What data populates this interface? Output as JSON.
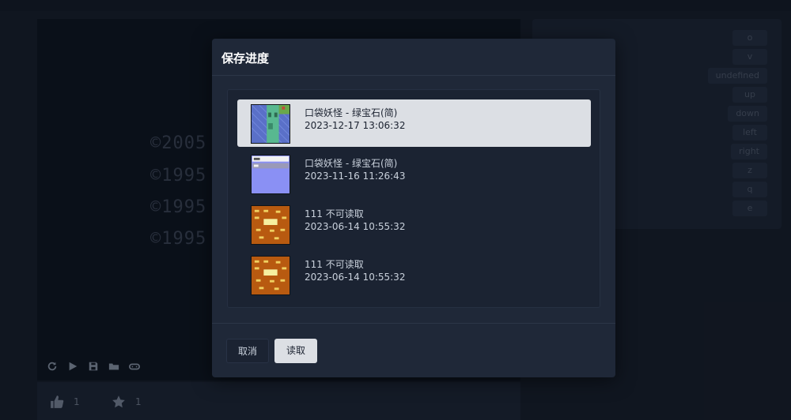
{
  "stage": {
    "copyright_lines": [
      "©2005",
      "©1995 -",
      "©1995 -",
      "©1995 -"
    ],
    "toolbar": [
      "restart-icon",
      "play-icon",
      "save-icon",
      "folder-icon",
      "gamepad-icon"
    ]
  },
  "stats": {
    "likes": "1",
    "stars": "1"
  },
  "keymap": [
    "o",
    "v",
    "undefined",
    "up",
    "down",
    "left",
    "right",
    "z",
    "q",
    "e"
  ],
  "modal": {
    "title": "保存进度",
    "saves": [
      {
        "name": "口袋妖怪 - 绿宝石(简)",
        "date": "2023-12-17 13:06:32",
        "selected": true,
        "thumb": "map"
      },
      {
        "name": "口袋妖怪 - 绿宝石(简)",
        "date": "2023-11-16 11:26:43",
        "selected": false,
        "thumb": "menu"
      },
      {
        "name": "111 不可读取",
        "date": "2023-06-14 10:55:32",
        "selected": false,
        "thumb": "brick"
      },
      {
        "name": "111 不可读取",
        "date": "2023-06-14 10:55:32",
        "selected": false,
        "thumb": "brick"
      }
    ],
    "cancel_label": "取消",
    "load_label": "读取"
  },
  "colors": {
    "accent": "#dcdfe4",
    "panel": "#1f2838",
    "background": "#151b26"
  }
}
